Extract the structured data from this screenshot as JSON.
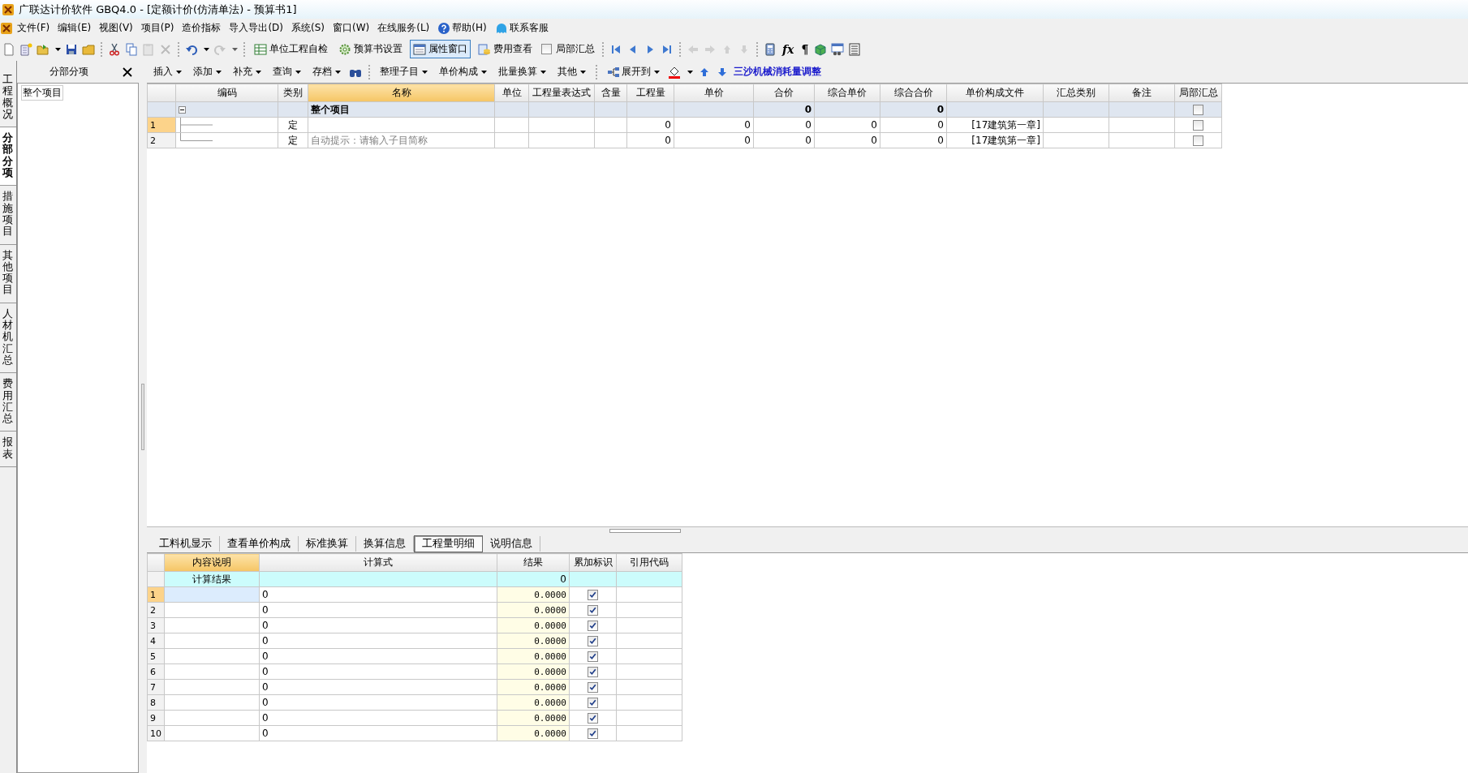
{
  "window": {
    "title": "广联达计价软件 GBQ4.0 - [定额计价(仿清单法) - 预算书1]"
  },
  "menu": [
    {
      "label": "文件(F)",
      "kind": "plain"
    },
    {
      "label": "编辑(E)",
      "kind": "plain"
    },
    {
      "label": "视图(V)",
      "kind": "plain"
    },
    {
      "label": "项目(P)",
      "kind": "plain"
    },
    {
      "label": "造价指标",
      "kind": "plain"
    },
    {
      "label": "导入导出(D)",
      "kind": "plain"
    },
    {
      "label": "系统(S)",
      "kind": "plain"
    },
    {
      "label": "窗口(W)",
      "kind": "plain"
    },
    {
      "label": "在线服务(L)",
      "kind": "plain"
    },
    {
      "label": "帮助(H)",
      "kind": "help"
    },
    {
      "label": "联系客服",
      "kind": "service"
    }
  ],
  "toolbar": {
    "buttons": [
      {
        "label": "单位工程自检",
        "pressed": false
      },
      {
        "label": "预算书设置",
        "pressed": false
      },
      {
        "label": "属性窗口",
        "pressed": true
      },
      {
        "label": "费用查看",
        "pressed": false
      }
    ],
    "checkbox": {
      "label": "局部汇总",
      "checked": false
    },
    "glyphs": [
      "fx",
      "¶"
    ]
  },
  "side_tabs": [
    {
      "label": "工程概况",
      "selected": false
    },
    {
      "label": "分部分项",
      "selected": true
    },
    {
      "label": "措施项目",
      "selected": false
    },
    {
      "label": "其他项目",
      "selected": false
    },
    {
      "label": "人材机汇总",
      "selected": false
    },
    {
      "label": "费用汇总",
      "selected": false
    },
    {
      "label": "报表",
      "selected": false
    }
  ],
  "left_panel": {
    "title": "分部分项",
    "tree": [
      {
        "label": "整个项目",
        "selected": true
      }
    ]
  },
  "toolbar2": {
    "items": [
      {
        "label": "插入"
      },
      {
        "label": "添加"
      },
      {
        "label": "补充"
      },
      {
        "label": "查询"
      },
      {
        "label": "存档"
      }
    ],
    "items2": [
      {
        "label": "整理子目"
      },
      {
        "label": "单价构成"
      },
      {
        "label": "批量换算"
      },
      {
        "label": "其他"
      }
    ],
    "expand": {
      "label": "展开到"
    },
    "link": {
      "label": "三沙机械消耗量调整"
    }
  },
  "table": {
    "columns": [
      {
        "label": "编码",
        "selected": false
      },
      {
        "label": "类别",
        "selected": false
      },
      {
        "label": "名称",
        "selected": true
      },
      {
        "label": "单位",
        "selected": false
      },
      {
        "label": "工程量表达式",
        "selected": false
      },
      {
        "label": "含量",
        "selected": false
      },
      {
        "label": "工程量",
        "selected": false
      },
      {
        "label": "单价",
        "selected": false
      },
      {
        "label": "合价",
        "selected": false
      },
      {
        "label": "综合单价",
        "selected": false
      },
      {
        "label": "综合合价",
        "selected": false
      },
      {
        "label": "单价构成文件",
        "selected": false
      },
      {
        "label": "汇总类别",
        "selected": false
      },
      {
        "label": "备注",
        "selected": false
      },
      {
        "label": "局部汇总",
        "selected": false
      }
    ],
    "rows": [
      {
        "kind": "group",
        "expanded": true,
        "cells": [
          "",
          "",
          "整个项目",
          "",
          "",
          "",
          "",
          "",
          "0",
          "",
          "0",
          "",
          "",
          ""
        ],
        "local_sum": false
      },
      {
        "kind": "item",
        "number": "1",
        "selected": true,
        "cells": [
          "",
          "定",
          "",
          "",
          "",
          "",
          "0",
          "0",
          "0",
          "0",
          "0",
          "[17建筑第一章]",
          "",
          ""
        ],
        "local_sum": false
      },
      {
        "kind": "item",
        "number": "2",
        "selected": false,
        "placeholder": "自动提示：请输入子目简称",
        "cells": [
          "",
          "定",
          "",
          "",
          "",
          "",
          "0",
          "0",
          "0",
          "0",
          "0",
          "[17建筑第一章]",
          "",
          ""
        ],
        "local_sum": false
      }
    ]
  },
  "detail": {
    "tabs": [
      {
        "label": "工料机显示",
        "selected": false
      },
      {
        "label": "查看单价构成",
        "selected": false
      },
      {
        "label": "标准换算",
        "selected": false
      },
      {
        "label": "换算信息",
        "selected": false
      },
      {
        "label": "工程量明细",
        "selected": true
      },
      {
        "label": "说明信息",
        "selected": false
      }
    ],
    "columns": [
      {
        "label": "内容说明",
        "selected": true
      },
      {
        "label": "计算式",
        "selected": false
      },
      {
        "label": "结果",
        "selected": false
      },
      {
        "label": "累加标识",
        "selected": false
      },
      {
        "label": "引用代码",
        "selected": false
      }
    ],
    "summary": {
      "label": "计算结果",
      "result": "0"
    },
    "rows": [
      {
        "number": "1",
        "selected": true,
        "formula": "0",
        "result": "0.0000",
        "accumulate": true
      },
      {
        "number": "2",
        "selected": false,
        "formula": "0",
        "result": "0.0000",
        "accumulate": true
      },
      {
        "number": "3",
        "selected": false,
        "formula": "0",
        "result": "0.0000",
        "accumulate": true
      },
      {
        "number": "4",
        "selected": false,
        "formula": "0",
        "result": "0.0000",
        "accumulate": true
      },
      {
        "number": "5",
        "selected": false,
        "formula": "0",
        "result": "0.0000",
        "accumulate": true
      },
      {
        "number": "6",
        "selected": false,
        "formula": "0",
        "result": "0.0000",
        "accumulate": true
      },
      {
        "number": "7",
        "selected": false,
        "formula": "0",
        "result": "0.0000",
        "accumulate": true
      },
      {
        "number": "8",
        "selected": false,
        "formula": "0",
        "result": "0.0000",
        "accumulate": true
      },
      {
        "number": "9",
        "selected": false,
        "formula": "0",
        "result": "0.0000",
        "accumulate": true
      },
      {
        "number": "10",
        "selected": false,
        "formula": "0",
        "result": "0.0000",
        "accumulate": true
      }
    ]
  }
}
